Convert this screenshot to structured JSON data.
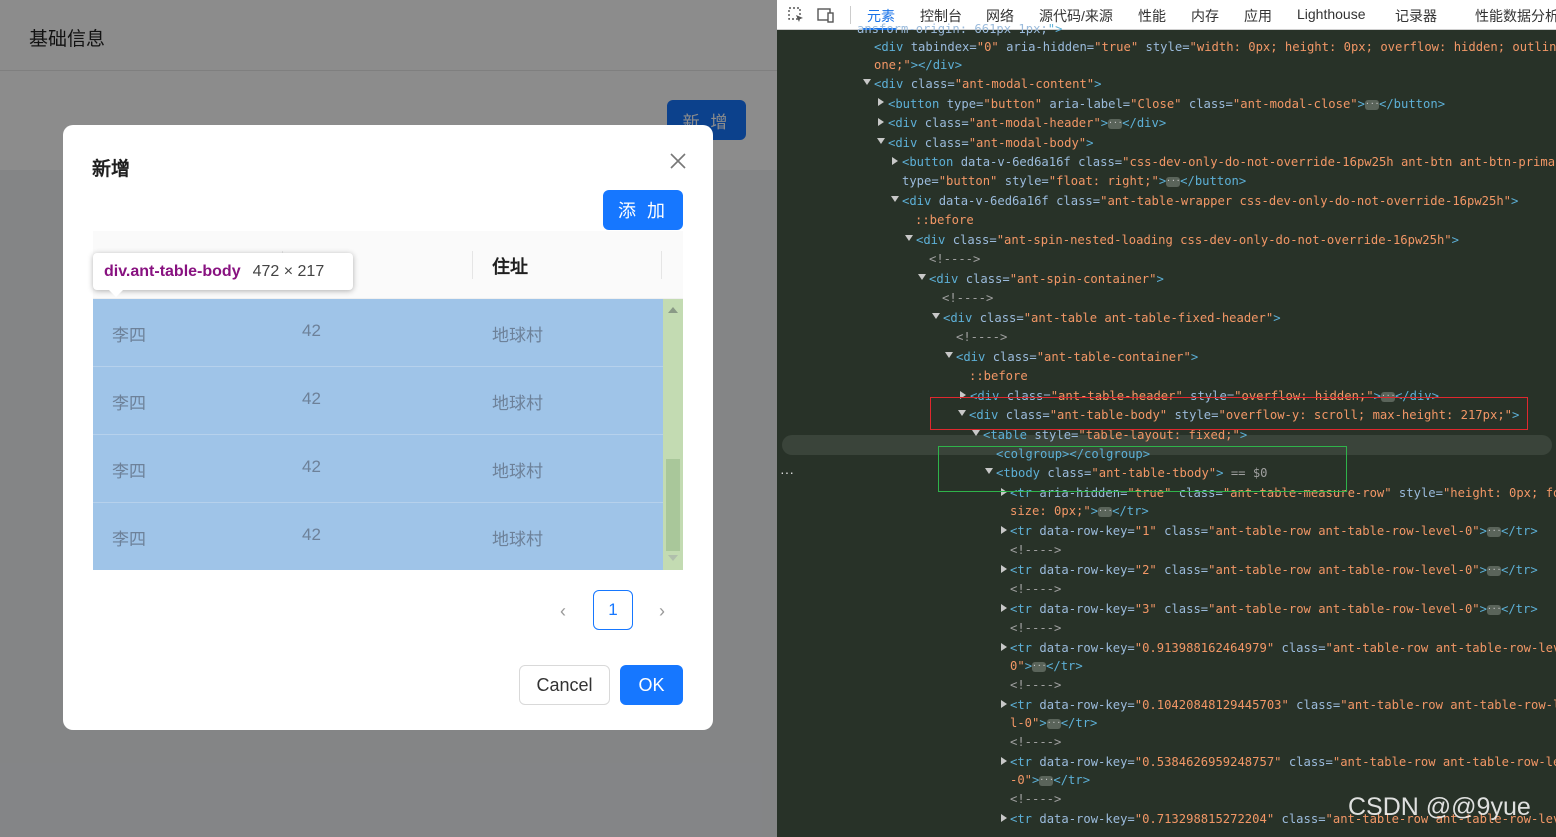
{
  "app": {
    "page_title": "基础信息",
    "page_add_label": "新 增",
    "modal": {
      "title": "新增",
      "add_label": "添 加",
      "columns": [
        "",
        "",
        "住址"
      ],
      "rows": [
        [
          "李四",
          "42",
          "地球村"
        ],
        [
          "李四",
          "42",
          "地球村"
        ],
        [
          "李四",
          "42",
          "地球村"
        ],
        [
          "李四",
          "42",
          "地球村"
        ]
      ],
      "page": "1",
      "prev": "‹",
      "next": "›",
      "cancel_label": "Cancel",
      "ok_label": "OK"
    },
    "tooltip": {
      "tag": "div.ant-table-body",
      "size": "472 × 217"
    }
  },
  "devtools": {
    "tabs": [
      "元素",
      "控制台",
      "网络",
      "源代码/来源",
      "性能",
      "内存",
      "应用",
      "Lighthouse",
      "记录器",
      "性能数据分析"
    ]
  },
  "watermark": "CSDN @@9yue",
  "colors": {
    "primary": "#1677ff",
    "highlight": "#9fc4e8",
    "devtools_bg": "#283228",
    "red_box": "#e0282e",
    "green_box": "#2fb34a"
  }
}
